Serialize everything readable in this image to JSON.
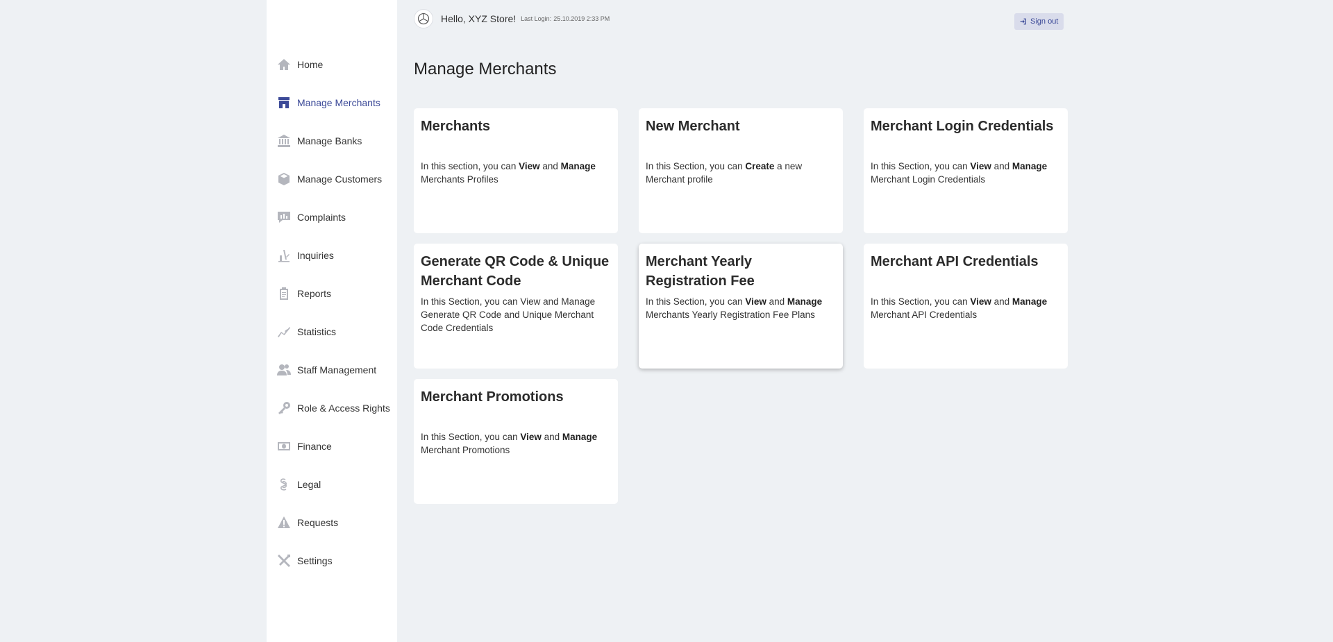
{
  "sidebar": {
    "items": [
      {
        "label": "Home",
        "icon": "home-icon"
      },
      {
        "label": "Manage Merchants",
        "icon": "store-icon",
        "active": true
      },
      {
        "label": "Manage Banks",
        "icon": "bank-icon"
      },
      {
        "label": "Manage Customers",
        "icon": "box-icon"
      },
      {
        "label": "Complaints",
        "icon": "complaint-icon"
      },
      {
        "label": "Inquiries",
        "icon": "inquiry-icon"
      },
      {
        "label": "Reports",
        "icon": "clipboard-icon"
      },
      {
        "label": "Statistics",
        "icon": "chart-line-icon"
      },
      {
        "label": "Staff Management",
        "icon": "users-icon"
      },
      {
        "label": "Role & Access Rights",
        "icon": "key-icon"
      },
      {
        "label": "Finance",
        "icon": "money-icon"
      },
      {
        "label": "Legal",
        "icon": "section-icon"
      },
      {
        "label": "Requests",
        "icon": "warning-icon"
      },
      {
        "label": "Settings",
        "icon": "tools-icon"
      }
    ]
  },
  "header": {
    "greeting": "Hello, XYZ Store!",
    "last_login_label": "Last Login:",
    "last_login_value": "25.10.2019 2:33 PM",
    "signout_label": "Sign out"
  },
  "page": {
    "title": "Manage Merchants"
  },
  "cards": [
    {
      "title": "Merchants",
      "desc": [
        {
          "t": "In this section, you can "
        },
        {
          "t": "View",
          "b": true
        },
        {
          "t": " and "
        },
        {
          "t": "Manage",
          "b": true
        },
        {
          "t": " Merchants Profiles"
        }
      ]
    },
    {
      "title": "New Merchant",
      "desc": [
        {
          "t": "In this Section, you can "
        },
        {
          "t": "Create",
          "b": true
        },
        {
          "t": " a new Merchant profile"
        }
      ]
    },
    {
      "title": "Merchant Login Credentials",
      "desc": [
        {
          "t": "In this Section, you can "
        },
        {
          "t": "View",
          "b": true
        },
        {
          "t": " and "
        },
        {
          "t": "Manage",
          "b": true
        },
        {
          "t": " Merchant Login Credentials"
        }
      ]
    },
    {
      "title": "Generate QR Code & Unique Merchant Code",
      "desc": [
        {
          "t": "In this Section, you can View and Manage Generate QR Code and Unique Merchant Code Credentials"
        }
      ]
    },
    {
      "title": "Merchant Yearly Registration Fee",
      "desc": [
        {
          "t": "In this Section, you can "
        },
        {
          "t": "View",
          "b": true
        },
        {
          "t": " and "
        },
        {
          "t": "Manage",
          "b": true
        },
        {
          "t": " Merchants Yearly Registration Fee Plans"
        }
      ]
    },
    {
      "title": "Merchant API Credentials",
      "desc": [
        {
          "t": "In this Section, you can "
        },
        {
          "t": "View",
          "b": true
        },
        {
          "t": " and "
        },
        {
          "t": "Manage",
          "b": true
        },
        {
          "t": " Merchant API Credentials"
        }
      ]
    },
    {
      "title": "Merchant Promotions",
      "desc": [
        {
          "t": "In this Section, you can "
        },
        {
          "t": "View",
          "b": true
        },
        {
          "t": " and "
        },
        {
          "t": "Manage",
          "b": true
        },
        {
          "t": " Merchant Promotions"
        }
      ]
    }
  ],
  "colors": {
    "accent": "#3c4a98",
    "background": "#eef1f4",
    "icon": "#b4b6bd"
  }
}
